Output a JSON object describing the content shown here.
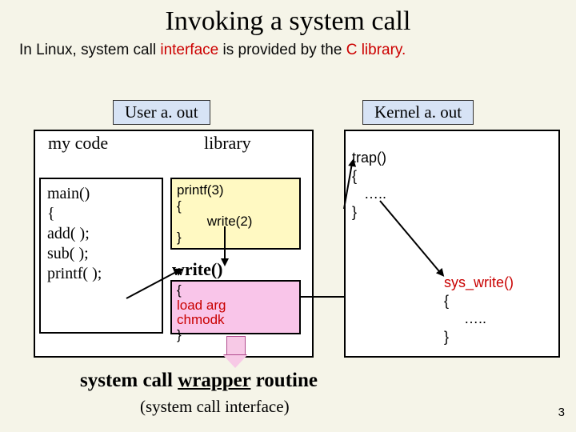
{
  "title": "Invoking a system call",
  "subtitle_pre": "In Linux, system call ",
  "subtitle_w1": "interface",
  "subtitle_mid": " is provided  by the ",
  "subtitle_w2": "C library",
  "subtitle_post": ".",
  "user_label": "User   a. out",
  "kernel_label": "Kernel   a. out",
  "mycode_heading": "my code",
  "library_heading": "library",
  "mycode": {
    "l1": "main()",
    "l2": "{",
    "l3": " add( );",
    "l4": " sub( );",
    "l5": " printf( );"
  },
  "printf_box": {
    "l1": "printf(3)",
    "l2": "{",
    "l3": "        write(2)",
    "l4": "}"
  },
  "write_label": "write()",
  "wrapper_box": {
    "l1": "{",
    "l2": " load arg",
    "l3": "  chmodk",
    "l4": "}"
  },
  "trap": {
    "l1": "trap()",
    "l2": "{",
    "l3": "   …..",
    "l4": "}"
  },
  "syswrite": {
    "l1": "sys_write()",
    "l2": "{",
    "l3": "     …..",
    "l4": "}"
  },
  "caption_1": "system call ",
  "caption_ul": "wrapper",
  "caption_2": " routine",
  "caption_sub": "(system call interface)",
  "slide_number": "3"
}
